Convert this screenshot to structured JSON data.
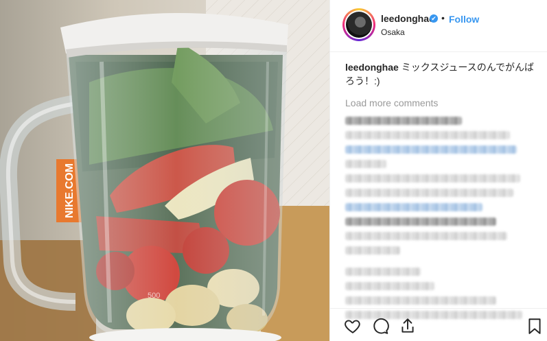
{
  "post": {
    "username": "leedonghae",
    "verified_glyph": "✔",
    "separator": "•",
    "follow_label": "Follow",
    "location": "Osaka",
    "caption_user": "leedonghae",
    "caption_text": "ミックスジュースのんでがんばろう！:)",
    "load_more": "Load more comments",
    "photo_text": "NIKE.COM",
    "measure_mark": "500"
  },
  "icons": {
    "like": "heart-icon",
    "comment": "comment-icon",
    "share": "share-icon",
    "save": "bookmark-icon"
  },
  "colors": {
    "link": "#3897f0",
    "muted": "#999999",
    "text": "#262626"
  }
}
